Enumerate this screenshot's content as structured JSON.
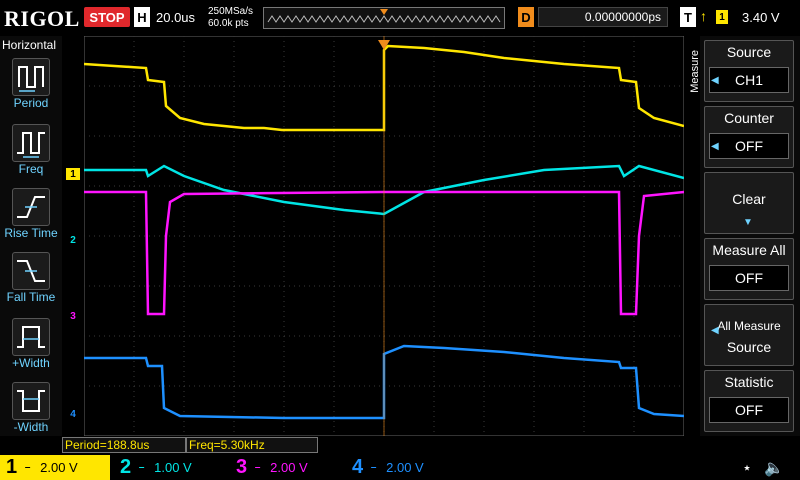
{
  "brand": "RIGOL",
  "run_state": "STOP",
  "timebase": {
    "label": "H",
    "value": "20.0us"
  },
  "acquisition": {
    "sample_rate": "250MSa/s",
    "memory": "60.0k pts"
  },
  "delay": {
    "label": "D",
    "value": "0.00000000ps"
  },
  "trigger": {
    "label": "T",
    "edge_glyph": "↑",
    "source": "1",
    "level": "3.40 V"
  },
  "left_menu": {
    "title": "Horizontal",
    "items": [
      {
        "label": "Period",
        "icon": "period-icon"
      },
      {
        "label": "Freq",
        "icon": "frequency-icon"
      },
      {
        "label": "Rise Time",
        "icon": "rise-time-icon"
      },
      {
        "label": "Fall Time",
        "icon": "fall-time-icon"
      },
      {
        "label": "+Width",
        "icon": "positive-width-icon"
      },
      {
        "label": "-Width",
        "icon": "negative-width-icon"
      }
    ]
  },
  "right_menu": {
    "side_label": "Measure",
    "source": {
      "title": "Source",
      "value": "CH1"
    },
    "counter": {
      "title": "Counter",
      "value": "OFF"
    },
    "clear": {
      "title": "Clear"
    },
    "measure_all": {
      "title": "Measure All",
      "value": "OFF"
    },
    "all_measure_source": {
      "line1": "All Measure",
      "line2": "Source"
    },
    "statistic": {
      "title": "Statistic",
      "value": "OFF"
    }
  },
  "measurements": [
    {
      "text": "Period=188.8us"
    },
    {
      "text": "Freq=5.30kHz"
    }
  ],
  "channels": [
    {
      "num": "1",
      "scale": "2.00 V",
      "color": "#ffe600"
    },
    {
      "num": "2",
      "scale": "1.00 V",
      "color": "#00e5e5"
    },
    {
      "num": "3",
      "scale": "2.00 V",
      "color": "#ff14ff"
    },
    {
      "num": "4",
      "scale": "2.00 V",
      "color": "#1e90ff"
    }
  ],
  "markers": {
    "trigger_marker": "T",
    "ch1": "1",
    "ch2": "2",
    "ch3": "3",
    "ch4": "4"
  },
  "colors": {
    "grid": "#3a3a3a",
    "accent": "#6fd3ff",
    "stop": "#e0282c",
    "delay": "#f08c1c"
  }
}
